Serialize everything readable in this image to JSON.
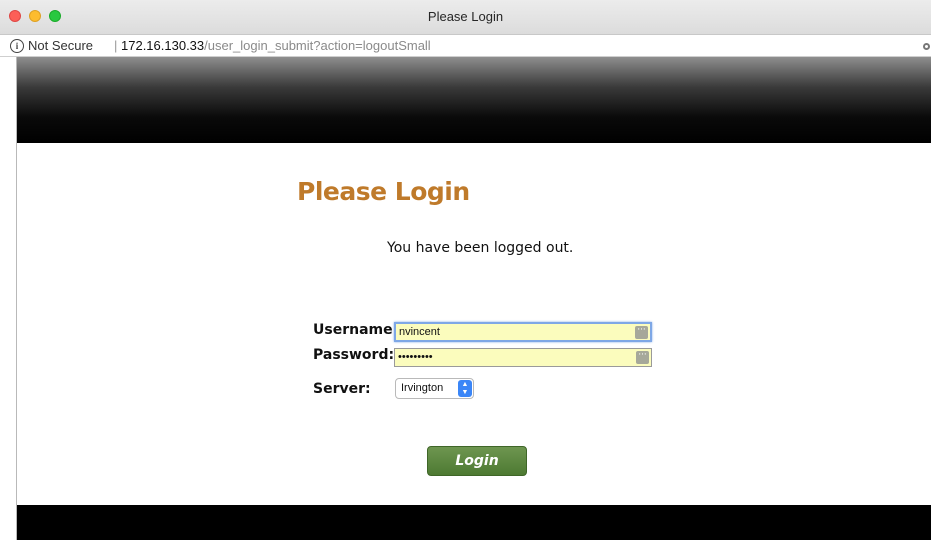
{
  "window": {
    "title": "Please Login"
  },
  "addressbar": {
    "security_label": "Not Secure",
    "separator": "|",
    "host": "172.16.130.33",
    "path": "/user_login_submit?action=logoutSmall"
  },
  "page": {
    "heading": "Please Login",
    "message": "You have been logged out."
  },
  "form": {
    "username_label": "Username:",
    "username_value": "nvincent",
    "password_label": "Password:",
    "password_value": "•••••••••",
    "server_label": "Server:",
    "server_selected": "Irvington",
    "submit_label": "Login"
  },
  "colors": {
    "heading": "#bf7a2a",
    "button": "#5a8640",
    "autofill": "#fbfcbd",
    "header_band": "#000000"
  }
}
